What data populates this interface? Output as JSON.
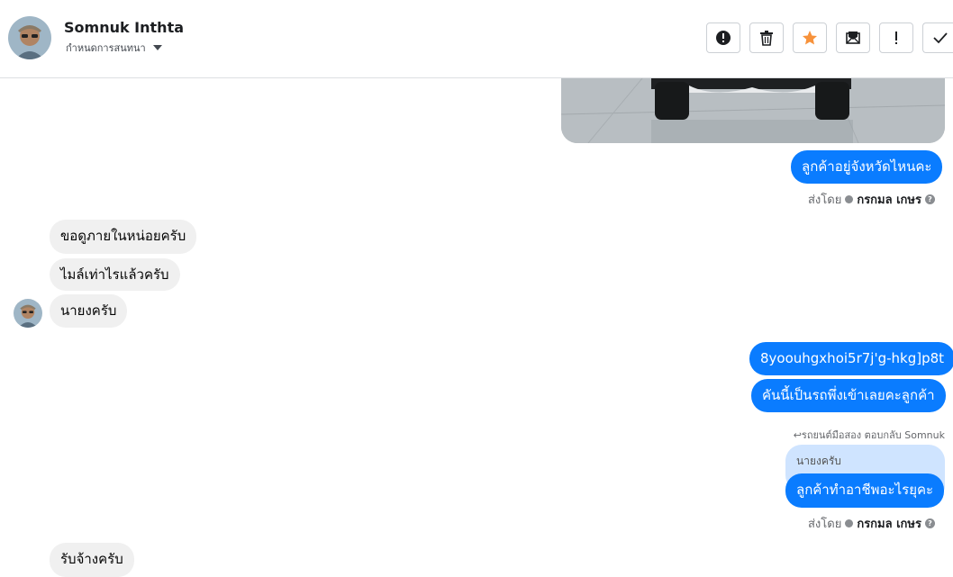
{
  "header": {
    "contact_name": "Somnuk Inthta",
    "subtitle": "กำหนดการสนทนา",
    "tools": [
      {
        "name": "report-button",
        "icon": "exclamation-circle-icon"
      },
      {
        "name": "delete-button",
        "icon": "trash-icon"
      },
      {
        "name": "star-button",
        "icon": "star-icon",
        "color": "#f7923b"
      },
      {
        "name": "mark-unread-button",
        "icon": "envelope-icon"
      },
      {
        "name": "important-button",
        "icon": "exclamation-icon"
      },
      {
        "name": "done-button",
        "icon": "check-icon"
      }
    ]
  },
  "messages": {
    "m1": "ลูกค้าอยู่จังหวัดไหนคะ",
    "sent1_prefix": "ส่งโดย",
    "sent1_by": "กรกมล เกษร",
    "m2": "ขอดูภายในหน่อยครับ",
    "m3": "ไมล์เท่าไรแล้วครับ",
    "m4": "นายงครับ",
    "m5": "8yoouhgxhoi5r7j'g-hkg]p8t",
    "m6": "คันนี้เป็นรถพึ่งเข้าเลยคะลูกค้า",
    "reply_label": "รถยนต์มือสอง ตอบกลับ Somnuk",
    "quoted": "นายงครับ",
    "m7": "ลูกค้าทำอาชีพอะไรยุคะ",
    "sent2_prefix": "ส่งโดย",
    "sent2_by": "กรกมล เกษร",
    "m8": "รับจ้างครับ"
  },
  "colors": {
    "outgoing": "#0a7cff",
    "incoming": "#f0f0f0",
    "quote_bg": "#cfe4ff"
  }
}
